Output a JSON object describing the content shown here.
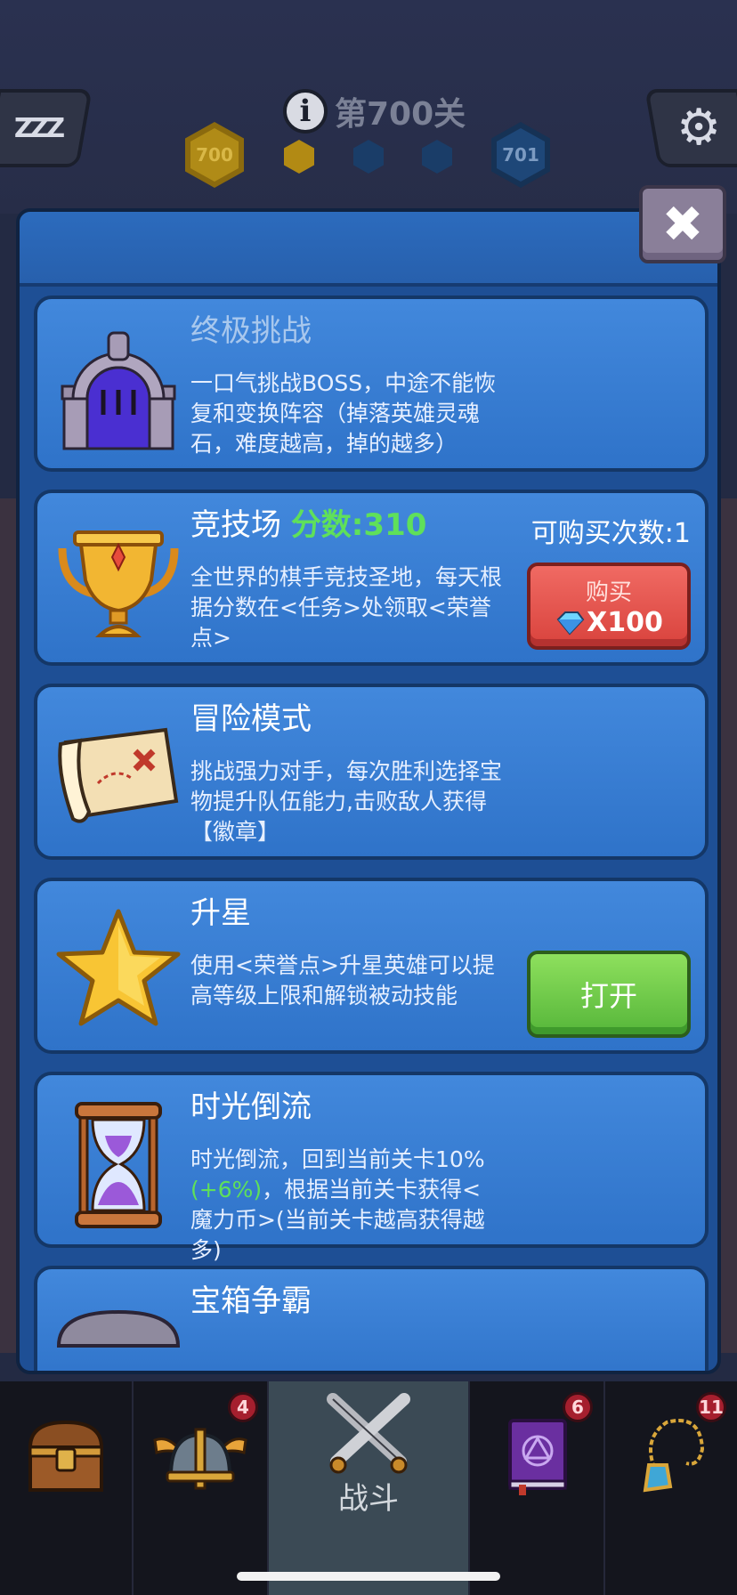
{
  "hud": {
    "sleep_label": "ZZZ",
    "level_title": "第700关",
    "current_level": "700",
    "next_level": "701"
  },
  "modes": [
    {
      "title": "终极挑战",
      "desc": "一口气挑战BOSS，中途不能恢复和变换阵容（掉落英雄灵魂石，难度越高，掉的越多）",
      "icon": "stone-gate-icon"
    },
    {
      "title": "竞技场",
      "score_label": "分数:310",
      "desc": "全世界的棋手竞技圣地，每天根据分数在<任务>处领取<荣誉点>",
      "buy_count": "可购买次数:1",
      "buy_label": "购买",
      "buy_price": "X100",
      "icon": "trophy-icon"
    },
    {
      "title": "冒险模式",
      "desc": "挑战强力对手，每次胜利选择宝物提升队伍能力,击败敌人获得【徽章】",
      "icon": "treasure-map-icon"
    },
    {
      "title": "升星",
      "desc": "使用<荣誉点>升星英雄可以提高等级上限和解锁被动技能",
      "open_label": "打开",
      "icon": "star-icon"
    },
    {
      "title": "时光倒流",
      "desc_part1": "时光倒流，回到当前关卡10%",
      "desc_bonus": "(+6%)",
      "desc_part2": "，根据当前关卡获得<魔力币>(当前关卡越高获得越多)",
      "icon": "hourglass-icon"
    },
    {
      "title": "宝箱争霸",
      "icon": "chest-lid-icon"
    }
  ],
  "nav": {
    "items": [
      {
        "icon": "treasure-chest-icon",
        "badge": ""
      },
      {
        "icon": "winged-helmet-icon",
        "badge": "4"
      },
      {
        "icon": "crossed-swords-icon",
        "label": "战斗"
      },
      {
        "icon": "spellbook-icon",
        "badge": "6"
      },
      {
        "icon": "amulet-icon",
        "badge": "11"
      }
    ]
  },
  "colors": {
    "card_blue": "#3a80d6",
    "score_green": "#5fe05a",
    "buy_red": "#e0524b",
    "open_green": "#6cc84a"
  }
}
